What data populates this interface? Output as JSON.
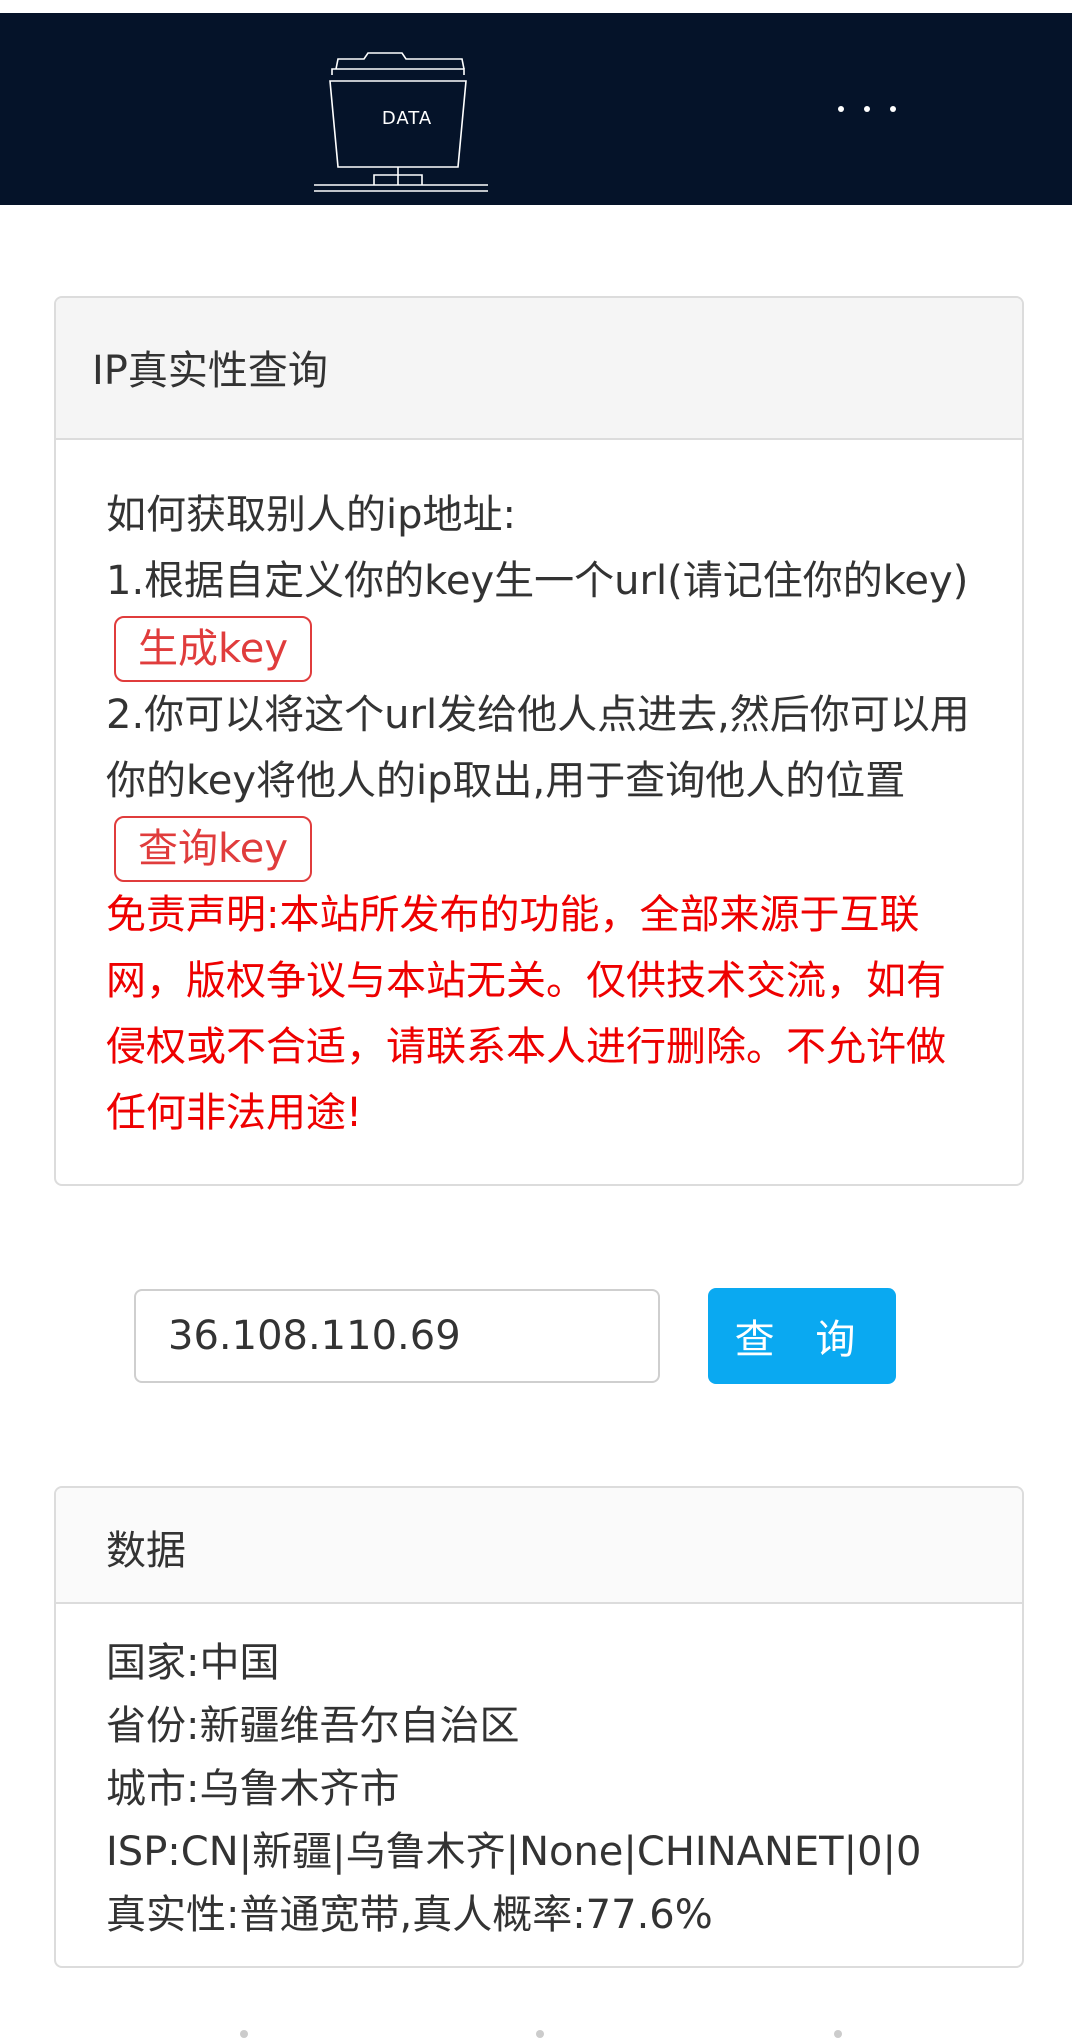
{
  "header": {
    "logo_text": "DATA",
    "logo_icon": "folder-network-icon",
    "more_icon": "more-dots-icon"
  },
  "panel1": {
    "title": "IP真实性查询",
    "line1": "如何获取别人的ip地址:",
    "line2": "1.根据自定义你的key生一个url(请记住你的key)",
    "gen_key_button": "生成key",
    "line3": "2.你可以将这个url发给他人点进去,然后你可以用你的key将他人的ip取出,用于查询他人的位置",
    "query_key_button": "查询key",
    "disclaimer": "免责声明:本站所发布的功能，全部来源于互联网，版权争议与本站无关。仅供技术交流，如有侵权或不合适，请联系本人进行删除。不允许做任何非法用途!"
  },
  "search": {
    "ip_value": "36.108.110.69",
    "button_label": "查 询"
  },
  "panel2": {
    "title": "数据",
    "rows": [
      "国家:中国",
      "省份:新疆维吾尔自治区",
      "城市:乌鲁木齐市",
      "ISP:CN|新疆|乌鲁木齐|None|CHINANET|0|0",
      "真实性:普通宽带,真人概率:77.6%"
    ]
  },
  "colors": {
    "header_bg": "#051329",
    "accent": "#0aa9f1",
    "warning": "#ee0000",
    "tag_border": "#e03c3c"
  }
}
